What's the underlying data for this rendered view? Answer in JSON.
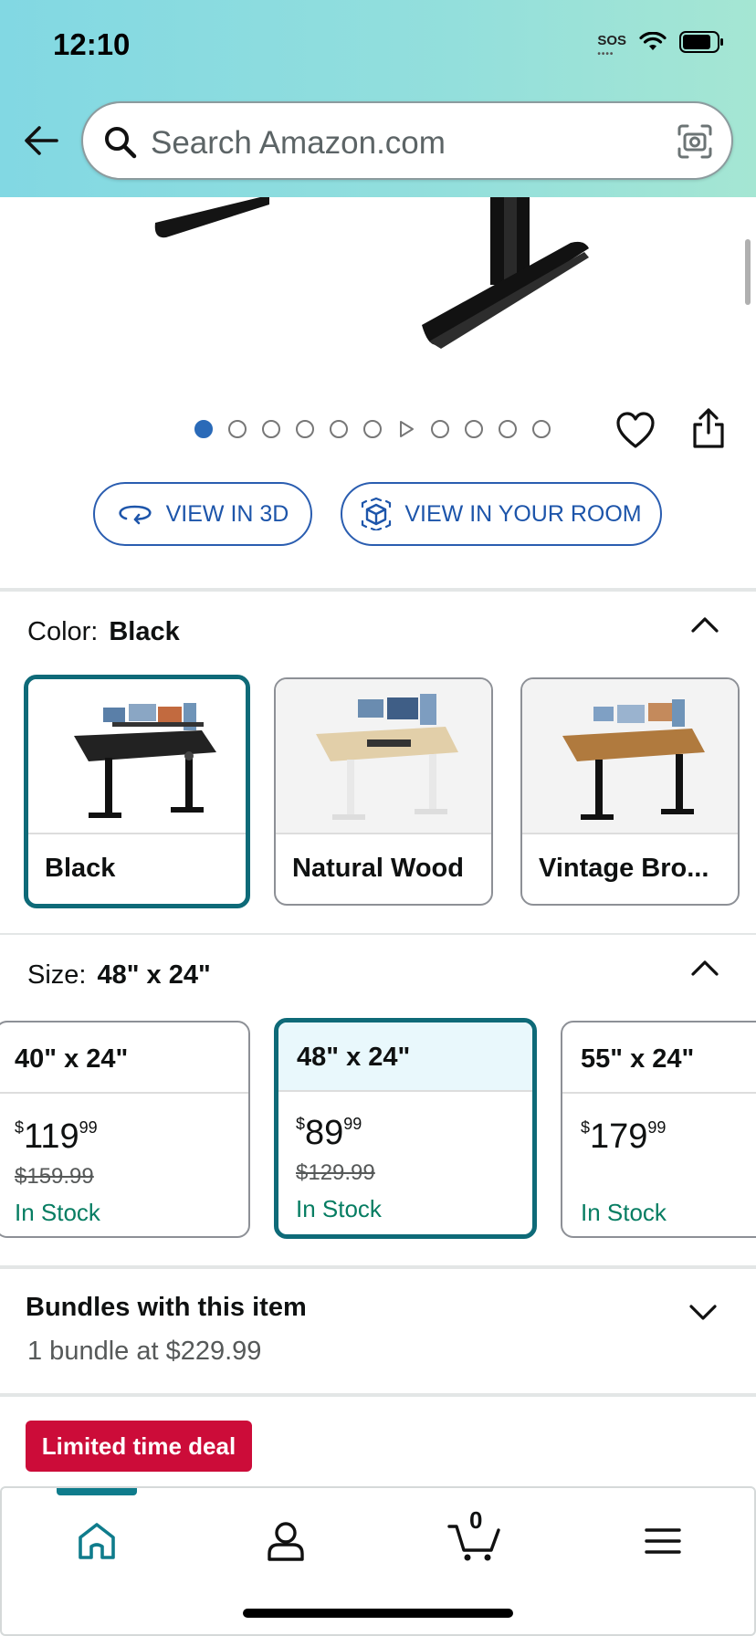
{
  "status_bar": {
    "time": "12:10",
    "sos": "SOS"
  },
  "header": {
    "search_placeholder": "Search Amazon.com"
  },
  "gallery": {
    "image_count": 11,
    "active_index": 0,
    "video_index": 5
  },
  "view_buttons": {
    "view_3d": "VIEW IN 3D",
    "view_room": "VIEW IN YOUR ROOM"
  },
  "color": {
    "label": "Color:",
    "selected": "Black",
    "options": [
      {
        "name": "Black"
      },
      {
        "name": "Natural Wood"
      },
      {
        "name": "Vintage Bro..."
      }
    ]
  },
  "size": {
    "label": "Size:",
    "selected": "48\" x 24\"",
    "options": [
      {
        "name": "40\" x 24\"",
        "price_symbol": "$",
        "price_whole": "119",
        "price_frac": "99",
        "list_price": "$159.99",
        "stock": "In Stock"
      },
      {
        "name": "48\" x 24\"",
        "price_symbol": "$",
        "price_whole": "89",
        "price_frac": "99",
        "list_price": "$129.99",
        "stock": "In Stock"
      },
      {
        "name": "55\" x 24\"",
        "price_symbol": "$",
        "price_whole": "179",
        "price_frac": "99",
        "list_price": "",
        "stock": "In Stock"
      }
    ]
  },
  "bundles": {
    "title": "Bundles with this item",
    "subtitle": "1 bundle at $229.99"
  },
  "deal_badge": "Limited time deal",
  "bottom_nav": {
    "cart_count": "0",
    "active": "home"
  },
  "colors": {
    "accent_teal": "#0e6a78",
    "link_blue": "#2a5db0",
    "deal_red": "#cc0c39",
    "stock_green": "#067d62"
  }
}
